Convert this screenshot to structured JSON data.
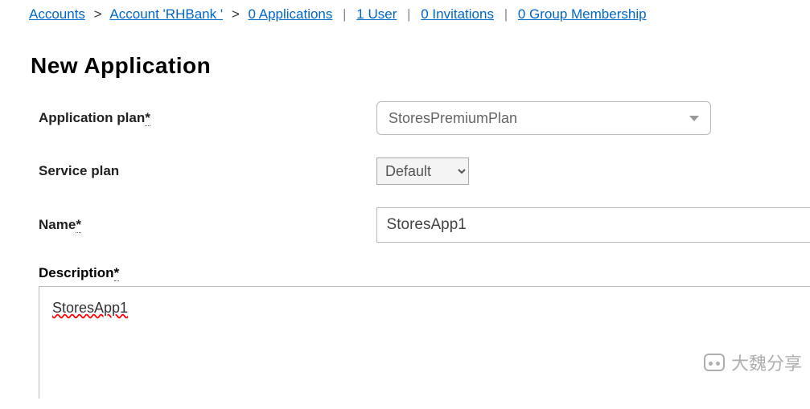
{
  "breadcrumb": {
    "accounts": "Accounts",
    "account": "Account 'RHBank '",
    "applications": "0 Applications",
    "user": "1 User",
    "invitations": "0 Invitations",
    "groups": "0 Group Membership"
  },
  "page": {
    "title": "New Application"
  },
  "form": {
    "app_plan_label": "Application plan",
    "app_plan_value": "StoresPremiumPlan",
    "service_plan_label": "Service plan",
    "service_plan_value": "Default",
    "name_label": "Name",
    "name_value": "StoresApp1",
    "desc_label": "Description",
    "desc_value": "StoresApp1"
  },
  "asterisk": "*",
  "watermark": "大魏分享"
}
